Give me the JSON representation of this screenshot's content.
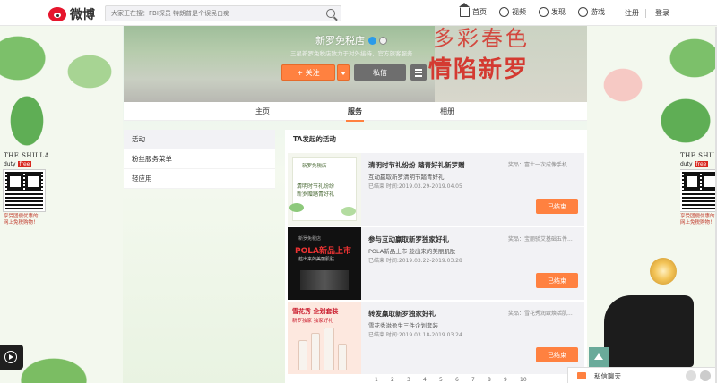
{
  "topbar": {
    "logo_text": "微博",
    "search_placeholder": "大家正在搜：FBI探员 特朗普是个误民白痴",
    "nav": [
      {
        "icon": "home-icon",
        "label": "首页"
      },
      {
        "icon": "video-icon",
        "label": "视频"
      },
      {
        "icon": "discover-icon",
        "label": "发现"
      },
      {
        "icon": "game-icon",
        "label": "游戏"
      }
    ],
    "register": "注册",
    "login": "登录"
  },
  "profile": {
    "name": "新罗免税店",
    "description": "三星新罗免税店致力于对外接待，官方旅客服务",
    "follow_label": "+ 关注",
    "message_label": "私信",
    "banner_slogan": "情陷新罗",
    "banner_slogan_top": "多彩春色"
  },
  "tabs": [
    {
      "label": "主页",
      "active": false
    },
    {
      "label": "服务",
      "active": true
    },
    {
      "label": "相册",
      "active": false
    }
  ],
  "left_nav": [
    {
      "label": "活动",
      "active": true
    },
    {
      "label": "粉丝服务菜单",
      "active": false
    },
    {
      "label": "轻应用",
      "active": false
    }
  ],
  "panel": {
    "title": "TA发起的活动",
    "activities": [
      {
        "title": "清明时节礼纷纷 踏青好礼新罗赠",
        "subtitle": "互动赢取新罗清明节踏青好礼",
        "time": "已结束 时间:2019.03.29-2019.04.05",
        "prize": "奖品：富士一次成像手机...",
        "button": "已结束",
        "thumb_line1": "新罗免税店",
        "thumb_line2": "清明时节礼纷纷",
        "thumb_line3": "新罗赠踏青好礼"
      },
      {
        "title": "参与互动赢取新罗独家好礼",
        "subtitle": "POLA新品上市 趁出来的美丽肌肤",
        "time": "已结束 时间:2019.03.22-2019.03.28",
        "prize": "奖品：宝丽骄艾基础五件...",
        "button": "已结束",
        "thumb_line1": "新罗免税店",
        "thumb_line2": "POLA新品上市",
        "thumb_line3": "趁出来的美丽肌肤"
      },
      {
        "title": "转发赢取新罗独家好礼",
        "subtitle": "雪花秀滋盈生三件企划套装",
        "time": "已结束 时间:2019.03.18-2019.03.24",
        "prize": "奖品：雪花秀润致焕活肌...",
        "button": "已结束",
        "thumb_line1": "雪花秀 企划套装",
        "thumb_line2": "新罗独家 独家好礼"
      }
    ]
  },
  "pager": [
    "1",
    "2",
    "3",
    "4",
    "5",
    "6",
    "7",
    "8",
    "9",
    "10"
  ],
  "shilla": {
    "brand": "THE SHILLA",
    "duty": "duty",
    "free": "free",
    "caption_line1": "享受团便优惠的",
    "caption_line2": "网上免税购物！"
  },
  "chat": {
    "label": "私信聊天"
  },
  "colors": {
    "accent": "#ff8140",
    "weibo_red": "#e6162d",
    "verified_blue": "#2b9be9"
  }
}
